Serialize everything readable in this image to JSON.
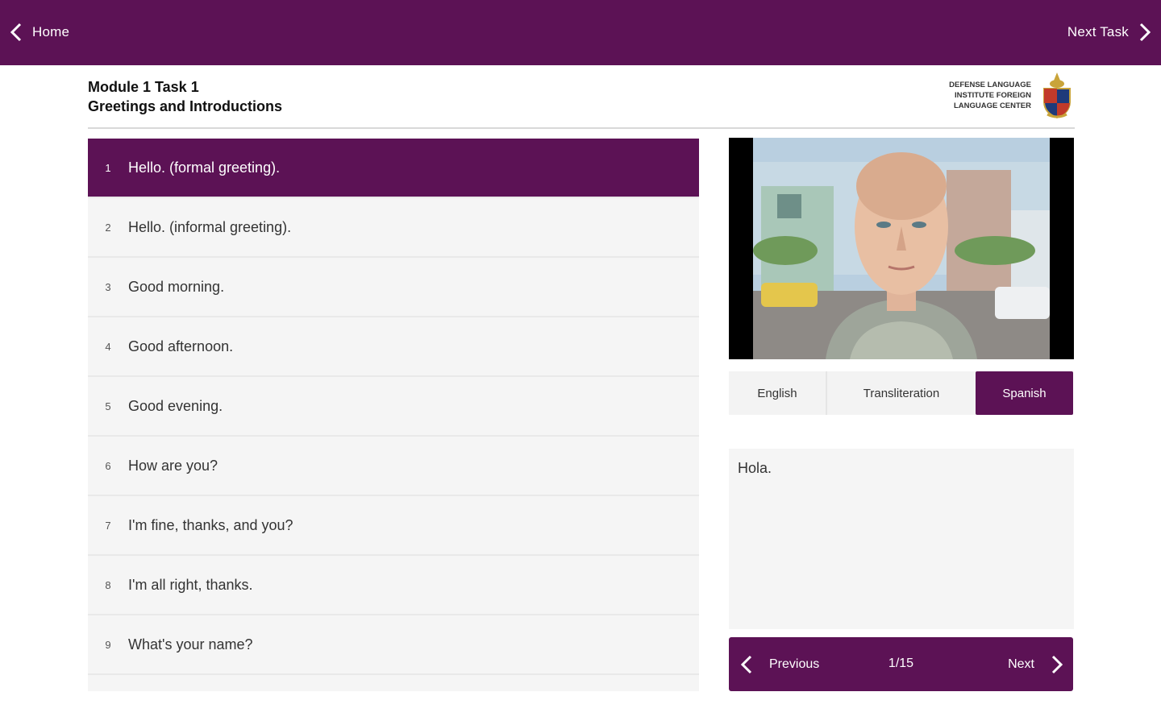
{
  "topbar": {
    "home_label": "Home",
    "next_task_label": "Next Task",
    "color": "#5c1255"
  },
  "header": {
    "module_line": "Module 1 Task 1",
    "subtitle": "Greetings and Introductions",
    "logo_lines": [
      "DEFENSE LANGUAGE",
      "INSTITUTE FOREIGN",
      "LANGUAGE CENTER"
    ]
  },
  "phrases": [
    {
      "num": "1",
      "text": "Hello. (formal greeting)."
    },
    {
      "num": "2",
      "text": "Hello. (informal greeting)."
    },
    {
      "num": "3",
      "text": "Good morning."
    },
    {
      "num": "4",
      "text": "Good afternoon."
    },
    {
      "num": "5",
      "text": "Good evening."
    },
    {
      "num": "6",
      "text": "How are you?"
    },
    {
      "num": "7",
      "text": "I'm fine, thanks, and you?"
    },
    {
      "num": "8",
      "text": "I'm all right, thanks."
    },
    {
      "num": "9",
      "text": "What's your name?"
    }
  ],
  "tabs": {
    "english": "English",
    "transliteration": "Transliteration",
    "spanish": "Spanish",
    "selected": "Spanish"
  },
  "translation_text": "Hola.",
  "pager": {
    "previous_label": "Previous",
    "count": "1/15",
    "next_label": "Next"
  }
}
